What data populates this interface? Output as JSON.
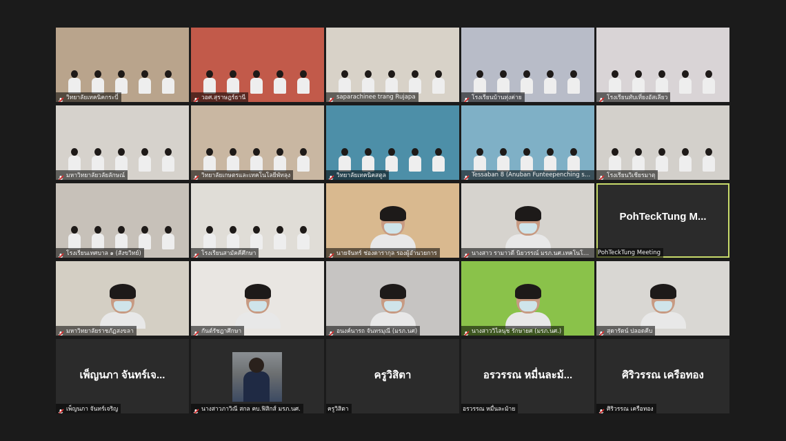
{
  "meeting": {
    "participants": [
      {
        "name": "วิทยาลัยเทคนิคกระบี่",
        "muted": true,
        "bg": "#b9a48c"
      },
      {
        "name": "วอศ.สุราษฎร์ธานี",
        "muted": true,
        "bg": "#c25a4a"
      },
      {
        "name": "saparachinee trang Rujapa",
        "muted": true,
        "bg": "#d8d2c8"
      },
      {
        "name": "โรงเรียนบ้านทุ่งค่าย",
        "muted": true,
        "bg": "#b8bcc8"
      },
      {
        "name": "โรงเรียนทับเที่ยงอัสเลียว",
        "muted": true,
        "bg": "#d9d4d6"
      },
      {
        "name": "มหาวิทยาลัยวลัยลักษณ์",
        "muted": true,
        "bg": "#d6d2cc"
      },
      {
        "name": "วิทยาลัยเกษตรและเทคโนโลยีพัทลุง",
        "muted": true,
        "bg": "#c9b7a2"
      },
      {
        "name": "วิทยาลัยเทคนิคสตูล",
        "muted": true,
        "bg": "#4d8fa8"
      },
      {
        "name": "Tessaban 8 (Anuban Funteepenching sc...",
        "muted": true,
        "bg": "#7fb0c6"
      },
      {
        "name": "โรงเรียนวิเชียรมาตุ",
        "muted": true,
        "bg": "#d3d0cb"
      },
      {
        "name": "โรงเรียนเทศบาล ๑ (สังขวิทย์)",
        "muted": true,
        "bg": "#c7c1b9"
      },
      {
        "name": "โรงเรียนสามัคคีศึกษา",
        "muted": true,
        "bg": "#e0ddd7"
      },
      {
        "name": "นายจันทร์ ช่องดารากุล รองผู้อำนวยการ",
        "muted": true,
        "bg": "#d9b98f"
      },
      {
        "name": "นางสาว รามาวดี นิยวรรณ์ มรภ.นศ.เทคโนโลยีก...",
        "muted": true,
        "bg": "#d6d3ce"
      },
      {
        "name": "PohTeckTung Meeting",
        "muted": false,
        "video_off": true,
        "display_name": "PohTeckTung  M...",
        "active": true
      },
      {
        "name": "มหาวิทยาลัยราชภัฏสงขลา",
        "muted": true,
        "bg": "#d4cfc4"
      },
      {
        "name": "กันต์รัชฎาศึกษา",
        "muted": true,
        "bg": "#e9e6e2"
      },
      {
        "name": "อนงค์นารถ จันทรมุณี (มรภ.นศ)",
        "muted": true,
        "bg": "#c6c4c2"
      },
      {
        "name": "นางสาววิไลนุช รักษายศ (มรภ.นศ.)",
        "muted": true,
        "bg": "#8ac24a"
      },
      {
        "name": "สุดารัตน์ ปลอดคีบ",
        "muted": true,
        "bg": "#d9d7d3"
      },
      {
        "name": "เพ็ญนภา จันทร์เจริญ",
        "muted": true,
        "video_off": true,
        "display_name": "เพ็ญนภา จันทร์เจ..."
      },
      {
        "name": "นางสาวภาวิณี สกล คบ.ฟิสิกส์ มรภ.นศ.",
        "muted": true,
        "video_off": true,
        "has_avatar": true
      },
      {
        "name": "ครูวิสิตา",
        "muted": false,
        "video_off": true,
        "display_name": "ครูวิสิตา"
      },
      {
        "name": "อรวรรณ หมื่นละม้าย",
        "muted": false,
        "video_off": true,
        "display_name": "อรวรรณ หมื่นละม้..."
      },
      {
        "name": "ศิริวรรณ เครือทอง",
        "muted": true,
        "video_off": true,
        "display_name": "ศิริวรรณ เครือทอง"
      }
    ]
  },
  "colors": {
    "background": "#1b1b1b",
    "tile_off": "#2b2b2b",
    "active_border": "#c9dc6b",
    "mute_red": "#e02b2b"
  },
  "icons": {
    "mute": "mic-muted-icon"
  }
}
